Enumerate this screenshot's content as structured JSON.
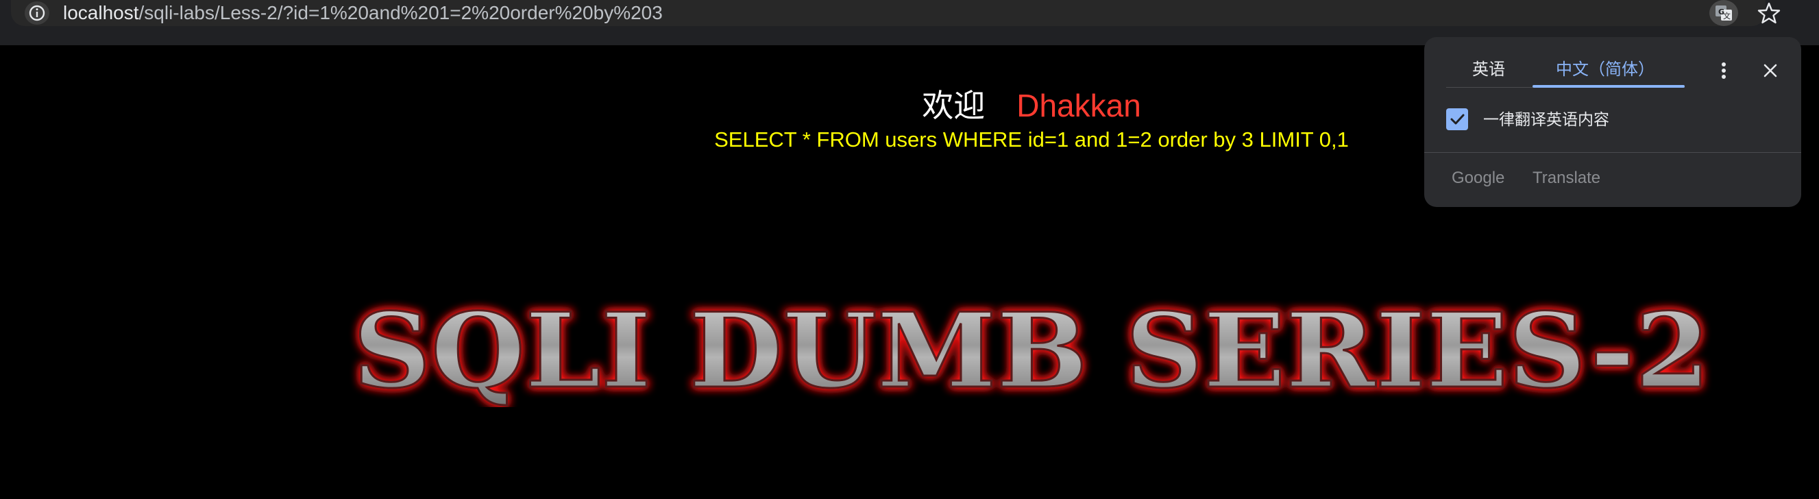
{
  "browser": {
    "url_host": "localhost",
    "url_path": "/sqli-labs/Less-2/?id=1%20and%201=2%20order%20by%203",
    "site_info_icon": "info-icon",
    "translate_icon": "translate-icon",
    "bookmark_icon": "star-icon"
  },
  "page": {
    "welcome_label": "欢迎",
    "welcome_name": "Dhakkan",
    "query_text": "SELECT * FROM users WHERE id=1 and 1=2 order by 3 LIMIT 0,1",
    "banner_text": "SQLI DUMB SERIES-2",
    "colors": {
      "background": "#000000",
      "welcome_label": "#ffffff",
      "welcome_name": "#ff3b30",
      "query": "#ffff00",
      "banner_glow": "#ff1a1a"
    }
  },
  "translate_popup": {
    "tabs": [
      {
        "label": "英语",
        "selected": false
      },
      {
        "label": "中文（简体）",
        "selected": true
      }
    ],
    "more_icon": "more-vert-icon",
    "close_icon": "close-icon",
    "checkbox_label": "一律翻译英语内容",
    "checkbox_checked": true,
    "footer_google": "Google",
    "footer_translate": "Translate",
    "accent_color": "#8ab4f8"
  }
}
